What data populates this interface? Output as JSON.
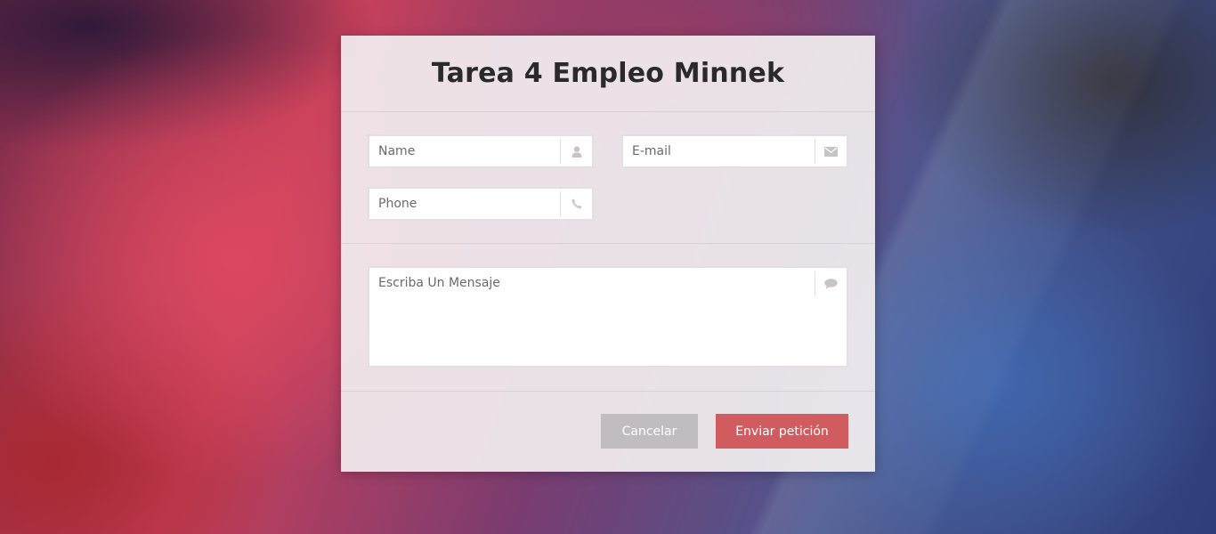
{
  "form": {
    "title": "Tarea 4 Empleo Minnek",
    "fields": {
      "name": {
        "placeholder": "Name",
        "value": "",
        "icon": "user-icon"
      },
      "email": {
        "placeholder": "E-mail",
        "value": "",
        "icon": "envelope-icon"
      },
      "phone": {
        "placeholder": "Phone",
        "value": "",
        "icon": "phone-icon"
      },
      "message": {
        "placeholder": "Escriba Un Mensaje",
        "value": "",
        "icon": "comment-icon"
      }
    },
    "buttons": {
      "cancel_label": "Cancelar",
      "submit_label": "Enviar petición"
    }
  },
  "colors": {
    "submit_button": "#d15c5f",
    "cancel_button": "#c0bcbf",
    "title_text": "#2a2a2a",
    "icon": "#c8c4c6"
  }
}
